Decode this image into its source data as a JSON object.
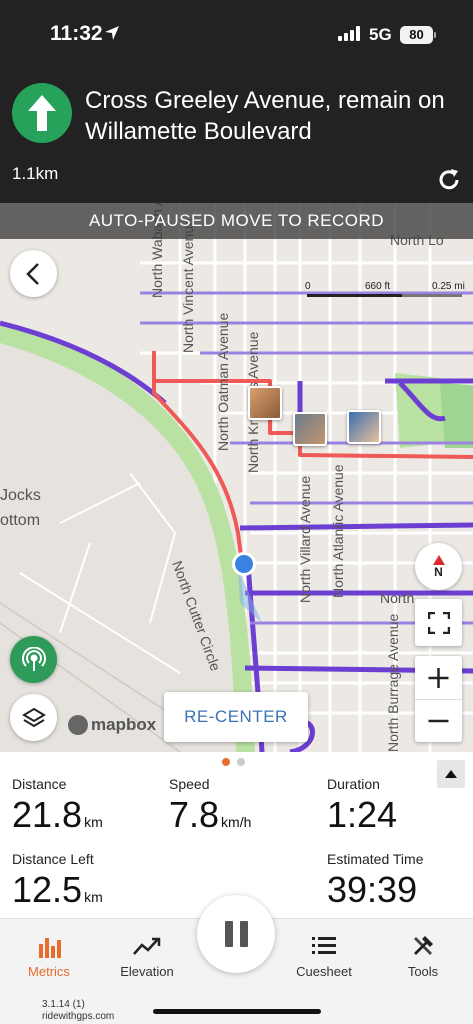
{
  "status_bar": {
    "time": "11:32",
    "network": "5G",
    "battery": "80",
    "icons": [
      "location-arrow-icon",
      "signal-icon",
      "battery-icon"
    ]
  },
  "navigation": {
    "instruction": "Cross Greeley Avenue, remain on Willamette Boulevard",
    "distance": "1.1km",
    "turn_icon": "straight-arrow-icon",
    "turn_color": "#27a25a"
  },
  "map": {
    "auto_pause_banner": "AUTO-PAUSED MOVE TO RECORD",
    "scale": {
      "start": "0",
      "mid": "660 ft",
      "end": "0.25 mi"
    },
    "compass_label": "N",
    "recenter_label": "RE-CENTER",
    "attribution": "mapbox",
    "street_labels": [
      "North Wabash Avenue",
      "North Vincent Avenue",
      "North Oatman Avenue",
      "North Knowles Avenue",
      "North Villard Avenue",
      "North Atlantic Avenue",
      "North Burrage Avenue",
      "North Cutter Circle",
      "North Lo",
      "North",
      "Jocks",
      "ottom"
    ],
    "route_color": "#ef5a58",
    "bike_lane_color": "#6c3ed1"
  },
  "metrics": {
    "page_dots": 2,
    "active_page": 1,
    "distance": {
      "label": "Distance",
      "value": "21.8",
      "unit": "km"
    },
    "speed": {
      "label": "Speed",
      "value": "7.8",
      "unit": "km/h"
    },
    "duration": {
      "label": "Duration",
      "value": "1:24"
    },
    "distance_left": {
      "label": "Distance Left",
      "value": "12.5",
      "unit": "km"
    },
    "estimated_time": {
      "label": "Estimated Time",
      "value": "39:39"
    }
  },
  "tabs": [
    {
      "label": "Metrics",
      "icon": "bar-chart-icon"
    },
    {
      "label": "Elevation",
      "icon": "trend-line-icon"
    },
    {
      "label": "Cuesheet",
      "icon": "list-icon"
    },
    {
      "label": "Tools",
      "icon": "tools-icon"
    }
  ],
  "accent_color": "#e66d2b",
  "footer": {
    "version": "3.1.14 (1)",
    "site": "ridewithgps.com"
  }
}
